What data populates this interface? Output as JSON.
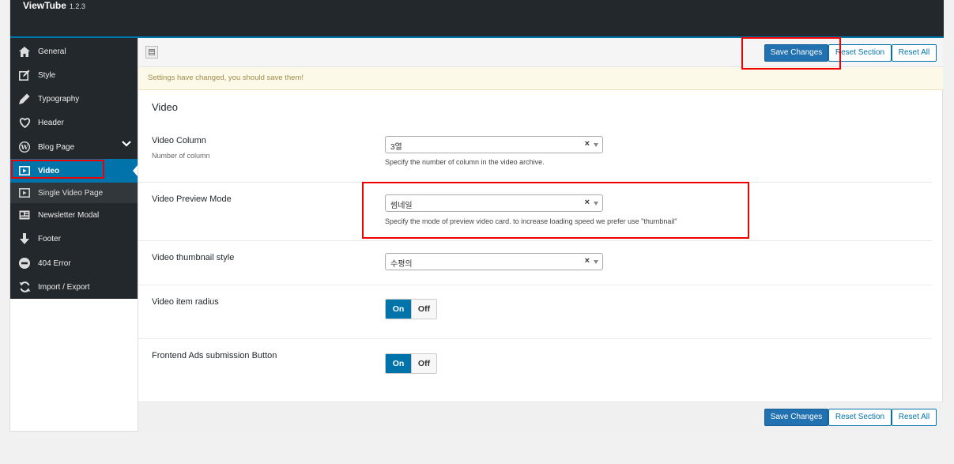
{
  "app": {
    "title": "ViewTube",
    "version": "1.2.3"
  },
  "sidebar": {
    "items": [
      {
        "label": "General",
        "icon": "home-icon"
      },
      {
        "label": "Style",
        "icon": "edit-icon"
      },
      {
        "label": "Typography",
        "icon": "pen-icon"
      },
      {
        "label": "Header",
        "icon": "heart-icon"
      },
      {
        "label": "Blog Page",
        "icon": "wordpress-icon"
      },
      {
        "label": "Video",
        "icon": "video-icon"
      },
      {
        "label": "Single Video Page",
        "icon": "video-icon"
      },
      {
        "label": "Newsletter Modal",
        "icon": "newsletter-icon"
      },
      {
        "label": "Footer",
        "icon": "arrow-down-icon"
      },
      {
        "label": "404 Error",
        "icon": "minus-circle-icon"
      },
      {
        "label": "Import / Export",
        "icon": "refresh-icon"
      }
    ]
  },
  "toolbar": {
    "save_label": "Save Changes",
    "reset_section_label": "Reset Section",
    "reset_all_label": "Reset All"
  },
  "notice": {
    "text": "Settings have changed, you should save them!"
  },
  "section": {
    "title": "Video",
    "fields": [
      {
        "label": "Video Column",
        "sublabel": "Number of column",
        "value": "3열",
        "description": "Specify the number of column in the video archive."
      },
      {
        "label": "Video Preview Mode",
        "value": "썸네일",
        "description": "Specify the mode of preview video card. to increase loading speed we prefer use \"thumbnail\""
      },
      {
        "label": "Video thumbnail style",
        "value": "수평의"
      },
      {
        "label": "Video item radius",
        "on_label": "On",
        "off_label": "Off"
      },
      {
        "label": "Frontend Ads submission Button",
        "on_label": "On",
        "off_label": "Off"
      }
    ]
  },
  "colors": {
    "accent": "#0073aa",
    "sidebar_bg": "#23282d",
    "highlight": "#e00000",
    "notice_bg": "#fcf9e8"
  }
}
